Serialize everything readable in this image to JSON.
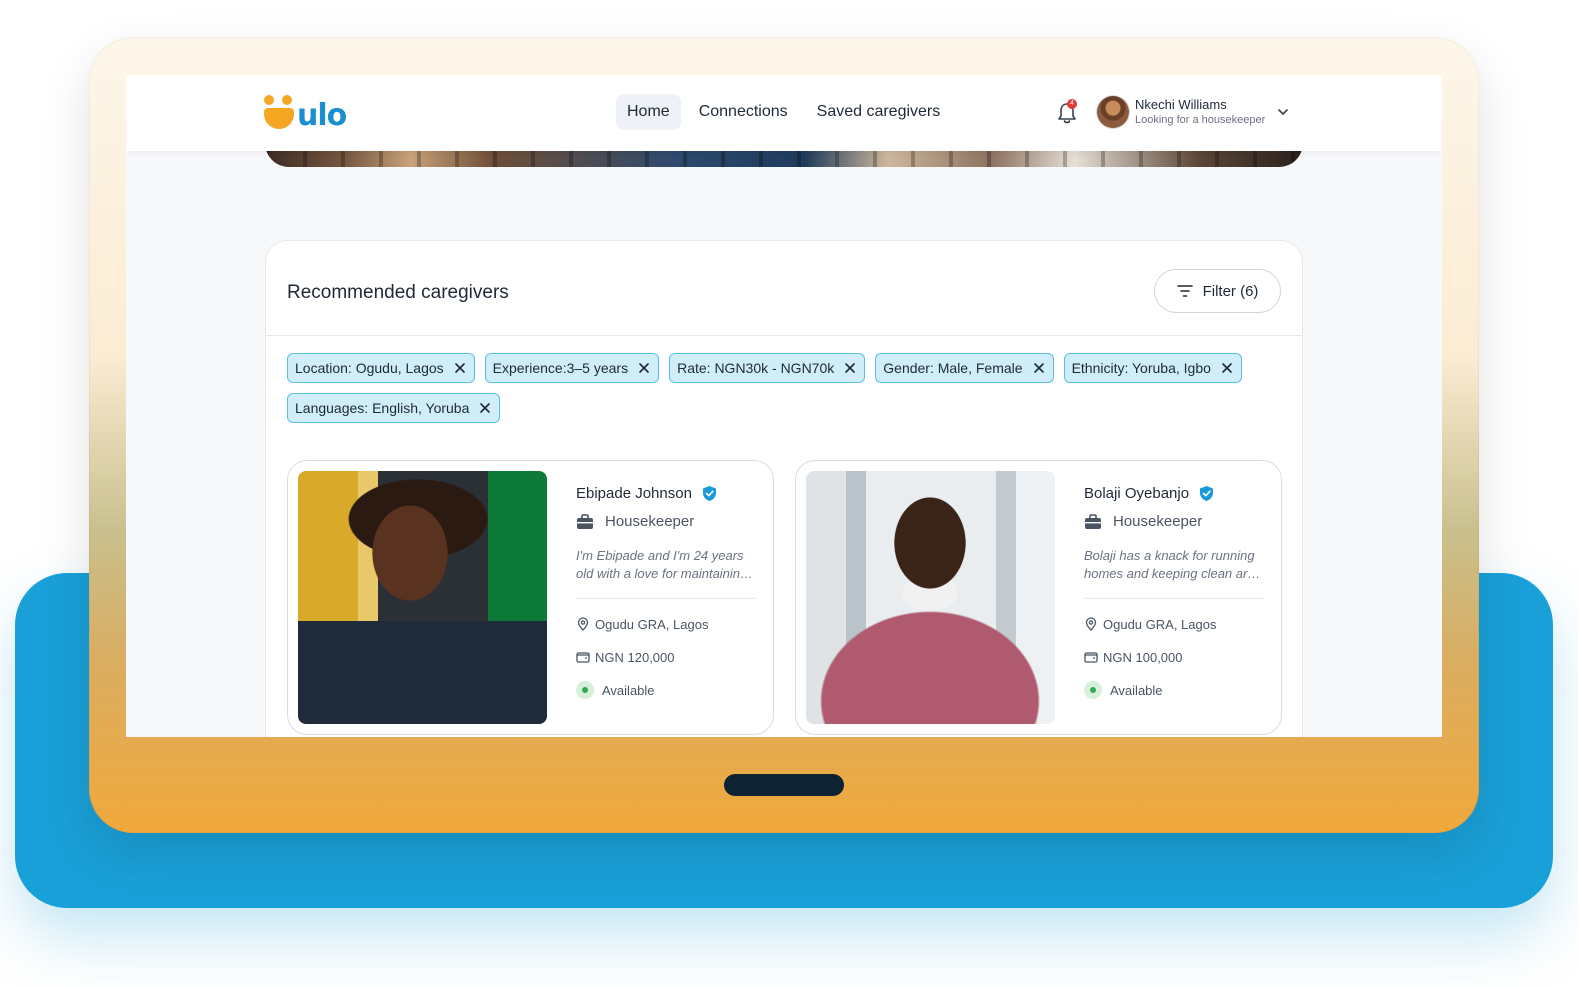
{
  "brand": {
    "name": "ulo",
    "primary": "#1a8fd0",
    "accent": "#f5a623"
  },
  "nav": {
    "links": [
      {
        "label": "Home",
        "active": true
      },
      {
        "label": "Connections",
        "active": false
      },
      {
        "label": "Saved caregivers",
        "active": false
      }
    ],
    "notifications": {
      "icon": "bell-icon",
      "count": "4"
    },
    "user": {
      "name": "Nkechi Williams",
      "role": "Looking for a housekeeper"
    }
  },
  "main": {
    "title": "Recommended caregivers",
    "filter_label": "Filter (6)",
    "filters": [
      "Location: Ogudu, Lagos",
      "Experience:3–5 years",
      "Rate: NGN30k - NGN70k",
      "Gender: Male, Female",
      "Ethnicity: Yoruba, Igbo",
      "Languages: English, Yoruba"
    ],
    "caregivers": [
      {
        "name": "Ebipade Johnson",
        "role": "Housekeeper",
        "bio_line1": "I'm Ebipade and I'm 24 years",
        "bio_line2": "old with a love for maintaining homes",
        "location": "Ogudu GRA, Lagos",
        "rate": "NGN 120,000",
        "status": "Available"
      },
      {
        "name": "Bolaji Oyebanjo",
        "role": "Housekeeper",
        "bio_line1": "Bolaji has a knack for running",
        "bio_line2": "homes and keeping clean areas",
        "location": "Ogudu GRA, Lagos",
        "rate": "NGN 100,000",
        "status": "Available"
      }
    ]
  }
}
